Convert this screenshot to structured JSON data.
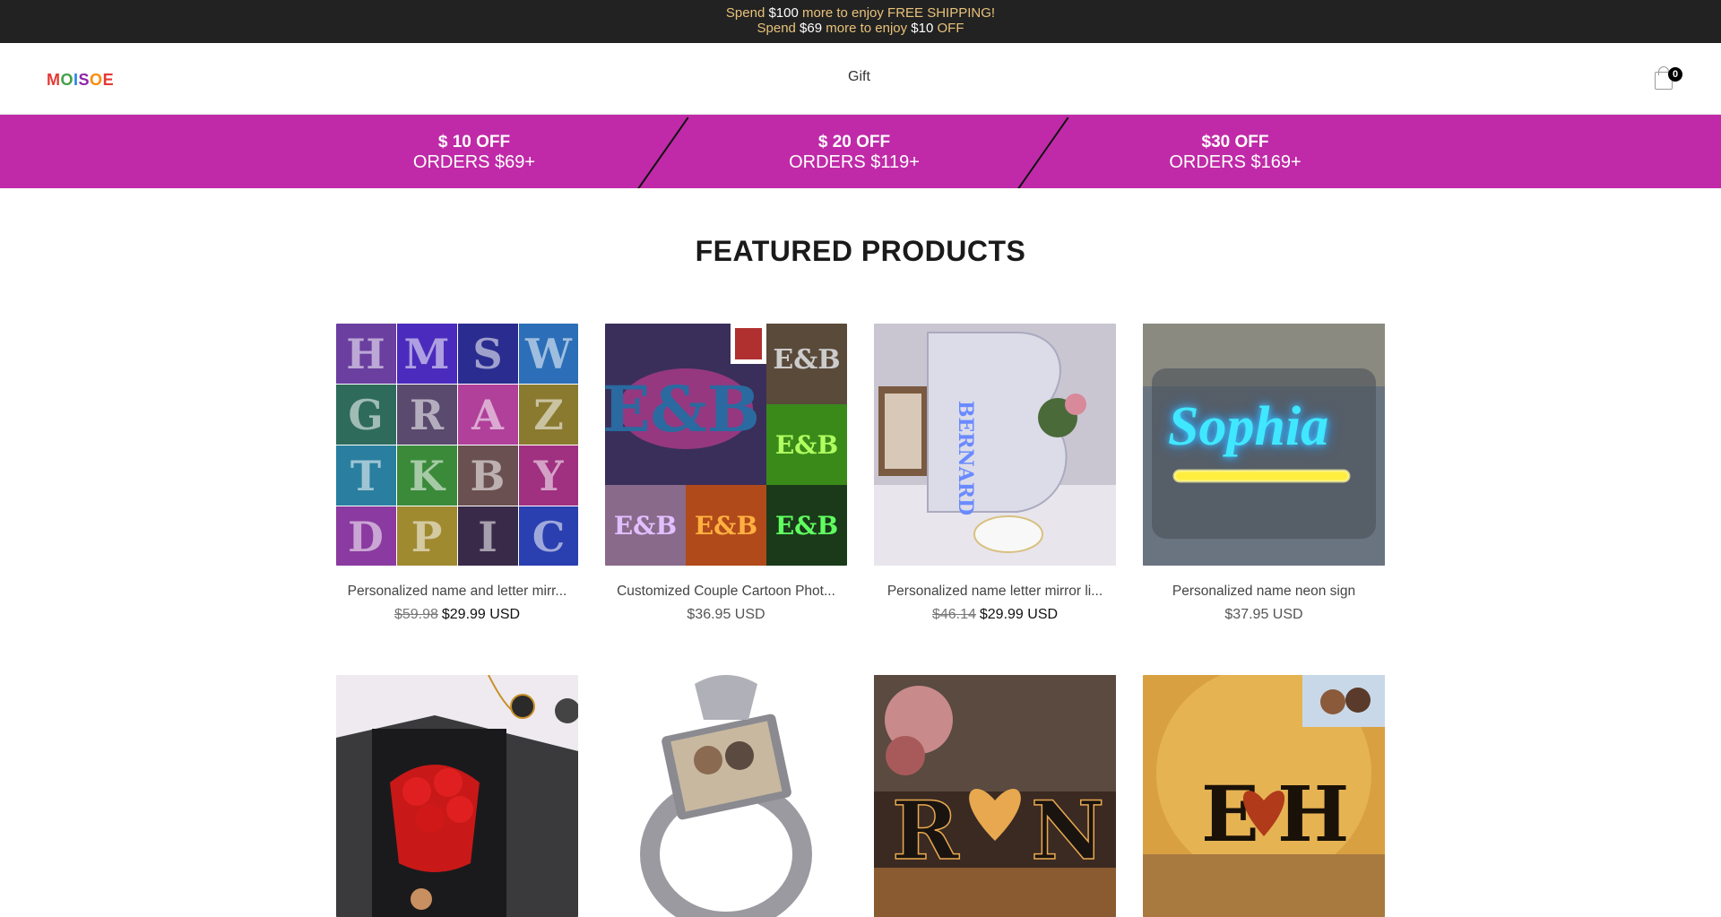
{
  "announcement": {
    "line1": {
      "pre": "Spend ",
      "amount": "$100",
      "post": " more to enjoy FREE SHIPPING!"
    },
    "line2": {
      "pre": "Spend ",
      "amount": "$69",
      "mid": " more to enjoy ",
      "amount2": "$10",
      "post": " OFF"
    }
  },
  "header": {
    "logo_letters": [
      "M",
      "O",
      "I",
      "S",
      "O",
      "E"
    ],
    "nav_gift": "Gift",
    "cart_count": "0"
  },
  "promo": [
    {
      "line1": "$ 10 OFF",
      "line2": "ORDERS $69+"
    },
    {
      "line1": "$ 20 OFF",
      "line2": "ORDERS $119+"
    },
    {
      "line1": "$30 OFF",
      "line2": "ORDERS $169+"
    }
  ],
  "featured": {
    "title": "FEATURED PRODUCTS",
    "products": [
      {
        "name": "Personalized name and letter mirr...",
        "old_price": "$59.98",
        "price": "$29.99 USD",
        "image_text": ""
      },
      {
        "name": "Customized Couple Cartoon Phot...",
        "old_price": "",
        "price": "$36.95 USD",
        "image_text": ""
      },
      {
        "name": "Personalized name letter mirror li...",
        "old_price": "$46.14",
        "price": "$29.99 USD",
        "image_text": ""
      },
      {
        "name": "Personalized name neon sign",
        "old_price": "",
        "price": "$37.95 USD",
        "image_text": "Sophia"
      },
      {
        "name": "",
        "old_price": "",
        "price": "",
        "image_text": ""
      },
      {
        "name": "",
        "old_price": "",
        "price": "",
        "image_text": ""
      },
      {
        "name": "",
        "old_price": "",
        "price": "",
        "image_text": ""
      },
      {
        "name": "",
        "old_price": "",
        "price": "",
        "image_text": ""
      }
    ]
  },
  "colors": {
    "announcement_bg": "#222222",
    "announcement_text": "#e8c27a",
    "promo_bg": "#c02aa8"
  }
}
